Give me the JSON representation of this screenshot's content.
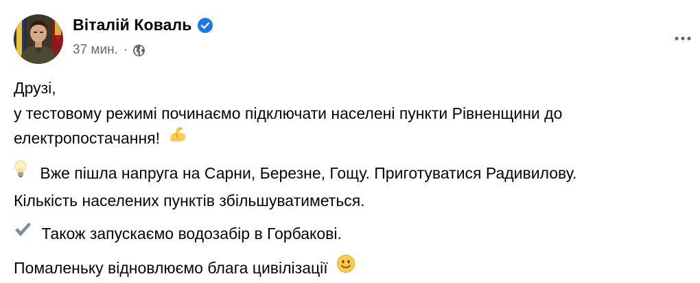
{
  "post": {
    "author_name": "Віталій Коваль",
    "timestamp": "37 мин.",
    "separator": "·",
    "audience_icon": "globe-icon",
    "verified_icon": "verified-badge-icon",
    "more_icon": "more-options-icon",
    "message": {
      "line1": "Друзі,",
      "line2": "у тестовому режимі починаємо підключати населені пункти Рівненщини до",
      "line3": "електропостачання!",
      "line3_emoji": "flexed-biceps-emoji",
      "p2_line1": "Вже пішла напруга на Сарни, Березне, Гощу. Приготуватися Радивилову.",
      "p2_emoji": "light-bulb-emoji",
      "p2_line2": "Кількість населених пунктів збільшуватиметься.",
      "p3_line1": "Також запускаємо водозабір в Горбакові.",
      "p3_emoji": "check-mark-emoji",
      "p4_line1": "Помаленьку відновлюємо блага цивілізації",
      "p4_emoji": "smiling-face-emoji"
    }
  },
  "colors": {
    "text_primary": "#050505",
    "text_secondary": "#65676b",
    "verified_blue": "#1877f2",
    "background": "#ffffff"
  }
}
